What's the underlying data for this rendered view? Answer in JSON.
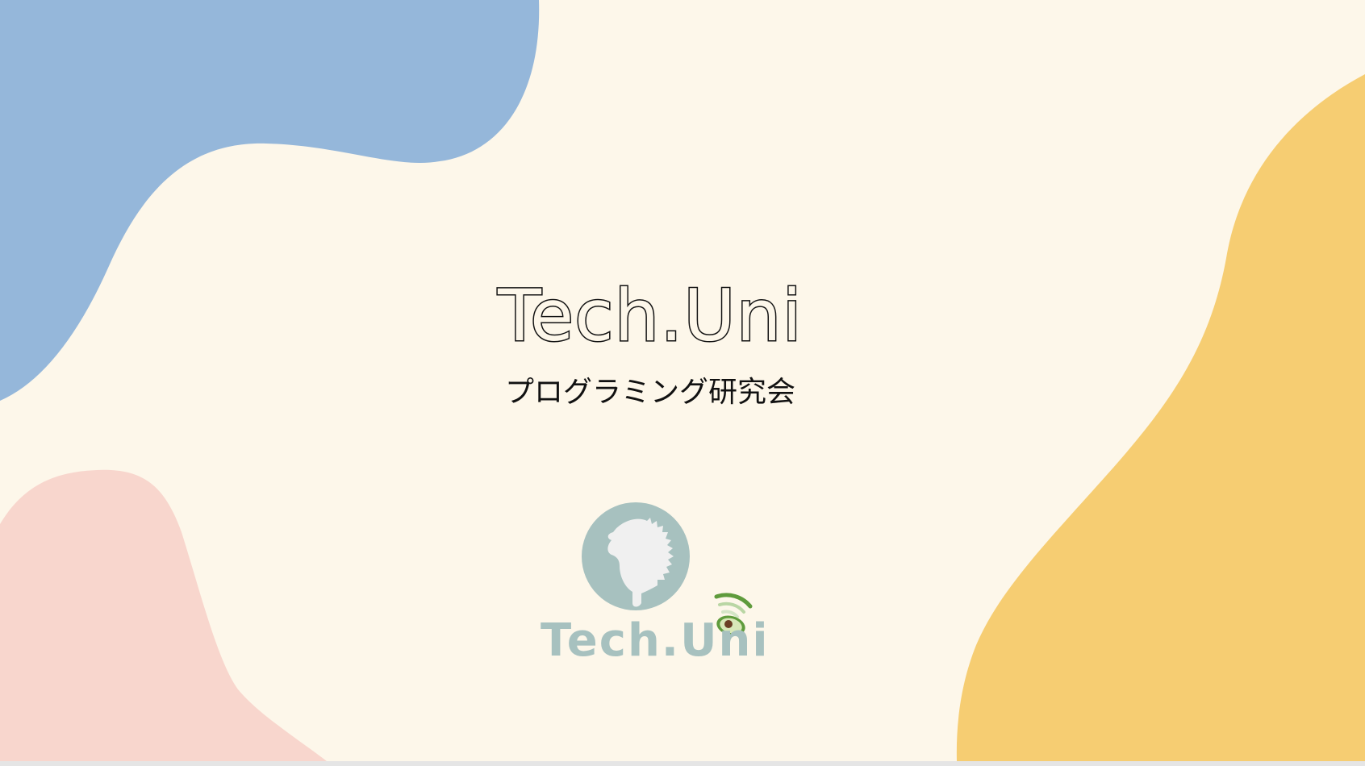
{
  "slide": {
    "title": "Tech.Uni",
    "subtitle": "プログラミング研究会",
    "logo_wordmark": "Tech.Uni"
  },
  "colors": {
    "background": "#fdf7ea",
    "blob_blue": "#95b7da",
    "blob_pink": "#f8d6cd",
    "blob_yellow": "#f6cd72",
    "logo_teal": "#a7c1bf",
    "logo_hedgehog": "#f0f0f0",
    "logo_avocado_green": "#5f9b3c"
  }
}
